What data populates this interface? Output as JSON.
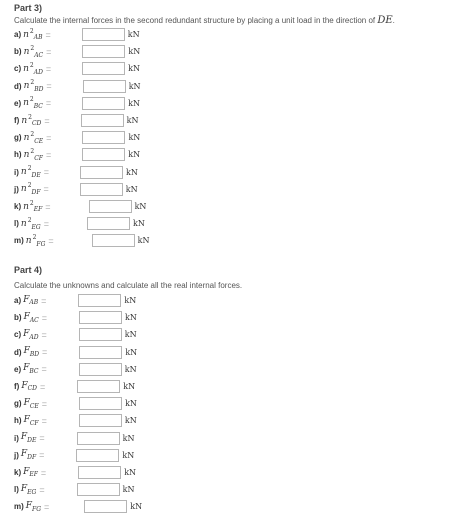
{
  "part3": {
    "title": "Part 3)",
    "instruction_prefix": "Calculate the internal forces in the second redundant structure by placing a unit load in the direction of ",
    "instruction_var": "DE",
    "instruction_suffix": ".",
    "rows": [
      {
        "label": "a)",
        "sub": "AB",
        "value": "",
        "unit": "kN"
      },
      {
        "label": "b)",
        "sub": "AC",
        "value": "",
        "unit": "kN"
      },
      {
        "label": "c)",
        "sub": "AD",
        "value": "",
        "unit": "kN"
      },
      {
        "label": "d)",
        "sub": "BD",
        "value": "",
        "unit": "kN"
      },
      {
        "label": "e)",
        "sub": "BC",
        "value": "",
        "unit": "kN"
      },
      {
        "label": "f)",
        "sub": "CD",
        "value": "",
        "unit": "kN"
      },
      {
        "label": "g)",
        "sub": "CE",
        "value": "",
        "unit": "kN"
      },
      {
        "label": "h)",
        "sub": "CF",
        "value": "",
        "unit": "kN"
      },
      {
        "label": "i)",
        "sub": "DE",
        "value": "",
        "unit": "kN"
      },
      {
        "label": "j)",
        "sub": "DF",
        "value": "",
        "unit": "kN"
      },
      {
        "label": "k)",
        "sub": "EF",
        "value": "",
        "unit": "kN"
      },
      {
        "label": "l)",
        "sub": "EG",
        "value": "",
        "unit": "kN"
      },
      {
        "label": "m)",
        "sub": "FG",
        "value": "",
        "unit": "kN"
      }
    ]
  },
  "part4": {
    "title": "Part 4)",
    "instruction": "Calculate the unknowns and calculate all the real internal forces.",
    "rows": [
      {
        "label": "a)",
        "sub": "AB",
        "value": "",
        "unit": "kN"
      },
      {
        "label": "b)",
        "sub": "AC",
        "value": "",
        "unit": "kN"
      },
      {
        "label": "c)",
        "sub": "AD",
        "value": "",
        "unit": "kN"
      },
      {
        "label": "d)",
        "sub": "BD",
        "value": "",
        "unit": "kN"
      },
      {
        "label": "e)",
        "sub": "BC",
        "value": "",
        "unit": "kN"
      },
      {
        "label": "f)",
        "sub": "CD",
        "value": "",
        "unit": "kN"
      },
      {
        "label": "g)",
        "sub": "CE",
        "value": "",
        "unit": "kN"
      },
      {
        "label": "h)",
        "sub": "CF",
        "value": "",
        "unit": "kN"
      },
      {
        "label": "i)",
        "sub": "DE",
        "value": "",
        "unit": "kN"
      },
      {
        "label": "j)",
        "sub": "DF",
        "value": "",
        "unit": "kN"
      },
      {
        "label": "k)",
        "sub": "EF",
        "value": "",
        "unit": "kN"
      },
      {
        "label": "l)",
        "sub": "EG",
        "value": "",
        "unit": "kN"
      },
      {
        "label": "m)",
        "sub": "FG",
        "value": "",
        "unit": "kN"
      }
    ]
  },
  "symbols": {
    "n": "n",
    "n_power": "2",
    "F": "F",
    "equals": "="
  }
}
